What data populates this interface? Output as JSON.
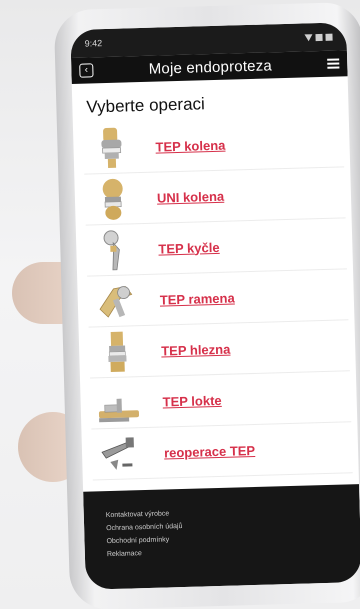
{
  "status_bar": {
    "time": "9:42"
  },
  "app_bar": {
    "title": "Moje endoproteza"
  },
  "screen_heading": "Vyberte operaci",
  "operations": [
    {
      "label": "TEP kolena",
      "icon": "knee-implant-icon"
    },
    {
      "label": "UNI kolena",
      "icon": "uni-knee-implant-icon"
    },
    {
      "label": "TEP kyčle",
      "icon": "hip-implant-icon"
    },
    {
      "label": "TEP ramena",
      "icon": "shoulder-implant-icon"
    },
    {
      "label": "TEP hlezna",
      "icon": "ankle-implant-icon"
    },
    {
      "label": "TEP lokte",
      "icon": "elbow-implant-icon"
    },
    {
      "label": "reoperace TEP",
      "icon": "revision-implant-icon"
    }
  ],
  "footer_links": [
    "Kontaktovat výrobce",
    "Ochrana osobních údajů",
    "Obchodní podmínky",
    "Reklamace"
  ],
  "colors": {
    "link": "#d6304a",
    "bar": "#111111",
    "footer": "#161616"
  }
}
